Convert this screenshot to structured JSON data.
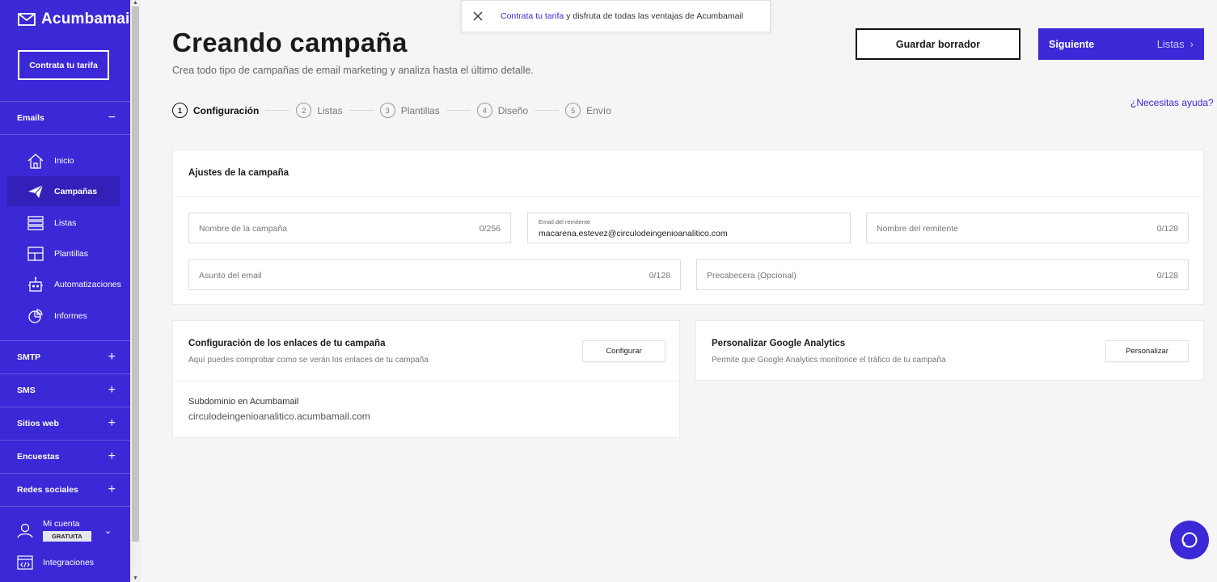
{
  "brand": {
    "name": "Acumbamail",
    "logo_icon": "envelope-icon"
  },
  "sidebar": {
    "cta_label": "Contrata tu tarifa",
    "emails_section": {
      "label": "Emails",
      "toggle": "−"
    },
    "items": [
      {
        "label": "Inicio",
        "icon": "home-icon",
        "active": false
      },
      {
        "label": "Campañas",
        "icon": "paper-plane-icon",
        "active": true
      },
      {
        "label": "Listas",
        "icon": "list-icon",
        "active": false
      },
      {
        "label": "Plantillas",
        "icon": "template-icon",
        "active": false
      },
      {
        "label": "Automatizaciones",
        "icon": "robot-icon",
        "active": false
      },
      {
        "label": "Informes",
        "icon": "chart-icon",
        "active": false
      }
    ],
    "sections": [
      {
        "label": "SMTP",
        "toggle": "+"
      },
      {
        "label": "SMS",
        "toggle": "+"
      },
      {
        "label": "Sitios web",
        "toggle": "+"
      },
      {
        "label": "Encuestas",
        "toggle": "+"
      },
      {
        "label": "Redes sociales",
        "toggle": "+"
      }
    ],
    "account": {
      "label": "Mi cuenta",
      "plan": "GRATUITA"
    },
    "integrations_label": "Integraciones"
  },
  "notice": {
    "link_text": "Contrata tu tarifa",
    "text": "y disfruta de todas las ventajas de Acumbamail"
  },
  "header": {
    "title": "Creando campaña",
    "subtitle": "Crea todo tipo de campañas de email marketing y analiza hasta el último detalle.",
    "draft_button": "Guardar borrador",
    "next_button": "Siguiente",
    "next_step": "Listas"
  },
  "steps": [
    {
      "num": "1",
      "label": "Configuración",
      "active": true
    },
    {
      "num": "2",
      "label": "Listas",
      "active": false
    },
    {
      "num": "3",
      "label": "Plantillas",
      "active": false
    },
    {
      "num": "4",
      "label": "Diseño",
      "active": false
    },
    {
      "num": "5",
      "label": "Envío",
      "active": false
    }
  ],
  "help_link": "¿Necesitas ayuda?",
  "settings_card": {
    "title": "Ajustes de la campaña",
    "fields": {
      "campaign_name": {
        "placeholder": "Nombre de la campaña",
        "counter": "0/256"
      },
      "sender_email": {
        "label": "Email del remitente",
        "value": "macarena.estevez@circulodeingenioanalitico.com"
      },
      "sender_name": {
        "placeholder": "Nombre del remitente",
        "counter": "0/128"
      },
      "subject": {
        "placeholder": "Asunto del email",
        "counter": "0/128"
      },
      "preheader": {
        "placeholder": "Precabecera (Opcional)",
        "counter": "0/128"
      }
    }
  },
  "links_card": {
    "title": "Configuración de los enlaces de tu campaña",
    "subtitle": "Aquí puedes comprobar como se verán los enlaces de tu campaña",
    "button": "Configurar",
    "subdomain_label": "Subdominio en Acumbamail",
    "subdomain_value": "circulodeingenioanalitico.acumbamail.com"
  },
  "analytics_card": {
    "title": "Personalizar Google Analytics",
    "subtitle": "Permite que Google Analytics monitorice el tráfico de tu campaña",
    "button": "Personalizar"
  },
  "colors": {
    "brand": "#3b28d6",
    "brand_dark": "#3320b8"
  }
}
